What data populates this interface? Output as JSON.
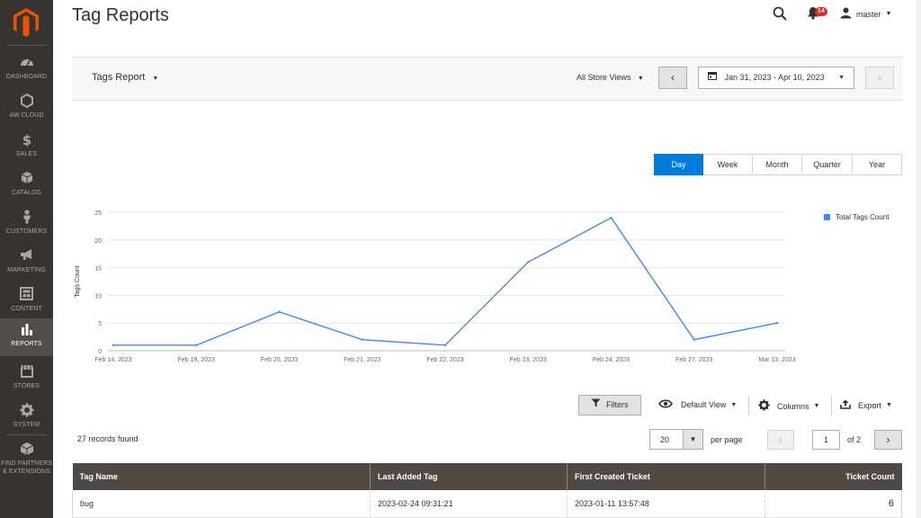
{
  "sidebar": {
    "items": [
      {
        "label": "DASHBOARD",
        "icon": "dashboard-icon"
      },
      {
        "label": "AW CLOUD",
        "icon": "hexagon-icon"
      },
      {
        "label": "SALES",
        "icon": "dollar-icon"
      },
      {
        "label": "CATALOG",
        "icon": "box-icon"
      },
      {
        "label": "CUSTOMERS",
        "icon": "person-icon"
      },
      {
        "label": "MARKETING",
        "icon": "megaphone-icon"
      },
      {
        "label": "CONTENT",
        "icon": "layout-icon"
      },
      {
        "label": "REPORTS",
        "icon": "bar-chart-icon",
        "active": true
      },
      {
        "label": "STORES",
        "icon": "storefront-icon"
      },
      {
        "label": "SYSTEM",
        "icon": "gear-icon"
      },
      {
        "label": "FIND PARTNERS",
        "label2": "& EXTENSIONS",
        "icon": "cube-icon"
      }
    ]
  },
  "header": {
    "title": "Tag Reports",
    "notifications_count": "14",
    "user": "master"
  },
  "toolbar": {
    "report_switch": "Tags Report",
    "store_views": "All Store Views",
    "date_range": "Jan 31, 2023 - Apr 10, 2023"
  },
  "periods": {
    "items": [
      "Day",
      "Week",
      "Month",
      "Quarter",
      "Year"
    ],
    "active": "Day"
  },
  "chart_data": {
    "type": "line",
    "categories": [
      "Feb 14, 2023",
      "Feb 19, 2023",
      "Feb 20, 2023",
      "Feb 21, 2023",
      "Feb 22, 2023",
      "Feb 23, 2023",
      "Feb 24, 2023",
      "Feb 27, 2023",
      "Mar 13, 2023"
    ],
    "series": [
      {
        "name": "Total Tags Count",
        "values": [
          1,
          1,
          7,
          2,
          1,
          16,
          24,
          2,
          5
        ],
        "color": "#4285f4"
      }
    ],
    "ylabel": "Tags Count",
    "yticks": [
      0,
      5,
      10,
      15,
      20,
      25
    ],
    "ylim": [
      0,
      25
    ],
    "grid": true,
    "legend": "right"
  },
  "grid_tools": {
    "filters": "Filters",
    "view": "Default View",
    "columns": "Columns",
    "export": "Export"
  },
  "pagination": {
    "records": "27 records found",
    "per_page": "20",
    "per_page_label": "per page",
    "page": "1",
    "of": "of 2"
  },
  "table": {
    "headers": [
      "Tag Name",
      "Last Added Tag",
      "First Created Ticket",
      "Ticket Count"
    ],
    "rows": [
      [
        "bug",
        "2023-02-24 09:31:21",
        "2023-01-11 13:57:48",
        "6"
      ]
    ]
  }
}
